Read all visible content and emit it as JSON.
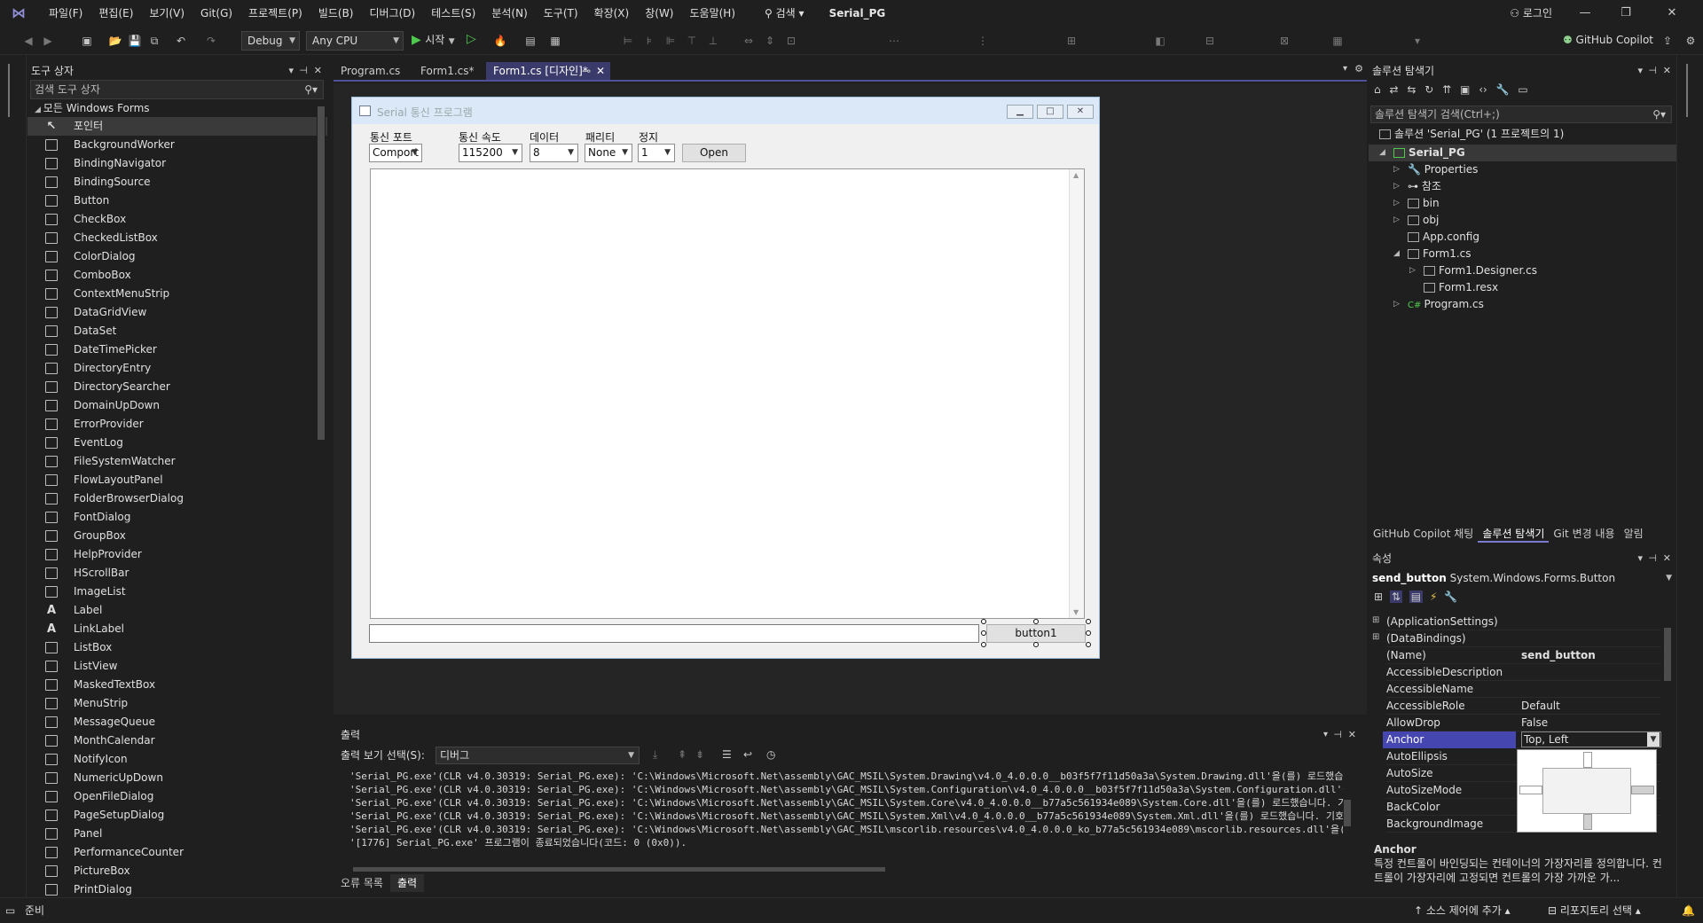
{
  "menu": {
    "items": [
      "파일(F)",
      "편집(E)",
      "보기(V)",
      "Git(G)",
      "프로젝트(P)",
      "빌드(B)",
      "디버그(D)",
      "테스트(S)",
      "분석(N)",
      "도구(T)",
      "확장(X)",
      "창(W)",
      "도움말(H)"
    ],
    "search": "검색",
    "app_title": "Serial_PG",
    "login": "로그인"
  },
  "toolbar": {
    "config": "Debug",
    "platform": "Any CPU",
    "start": "시작",
    "copilot": "GitHub Copilot"
  },
  "toolbox": {
    "title": "도구 상자",
    "search_placeholder": "검색 도구 상자",
    "group": "모든 Windows Forms",
    "items": [
      "포인터",
      "BackgroundWorker",
      "BindingNavigator",
      "BindingSource",
      "Button",
      "CheckBox",
      "CheckedListBox",
      "ColorDialog",
      "ComboBox",
      "ContextMenuStrip",
      "DataGridView",
      "DataSet",
      "DateTimePicker",
      "DirectoryEntry",
      "DirectorySearcher",
      "DomainUpDown",
      "ErrorProvider",
      "EventLog",
      "FileSystemWatcher",
      "FlowLayoutPanel",
      "FolderBrowserDialog",
      "FontDialog",
      "GroupBox",
      "HelpProvider",
      "HScrollBar",
      "ImageList",
      "Label",
      "LinkLabel",
      "ListBox",
      "ListView",
      "MaskedTextBox",
      "MenuStrip",
      "MessageQueue",
      "MonthCalendar",
      "NotifyIcon",
      "NumericUpDown",
      "OpenFileDialog",
      "PageSetupDialog",
      "Panel",
      "PerformanceCounter",
      "PictureBox",
      "PrintDialog"
    ]
  },
  "tabs": [
    "Program.cs",
    "Form1.cs*",
    "Form1.cs [디자인]*"
  ],
  "form": {
    "title": "Serial 통신 프로그램",
    "labels": {
      "port": "통신 포트",
      "baud": "통신 속도",
      "data": "데이터",
      "parity": "패리티",
      "stop": "정지"
    },
    "combos": {
      "port": "Comport",
      "baud": "115200",
      "data": "8",
      "parity": "None",
      "stop": "1"
    },
    "open": "Open",
    "button1": "button1"
  },
  "output": {
    "title": "출력",
    "source_label": "출력 보기 선택(S):",
    "source": "디버그",
    "lines": [
      "'Serial_PG.exe'(CLR v4.0.30319: Serial_PG.exe): 'C:\\Windows\\Microsoft.Net\\assembly\\GAC_MSIL\\System.Drawing\\v4.0_4.0.0.0__b03f5f7f11d50a3a\\System.Drawing.dll'을(를) 로드했습니다. 기호를 로",
      "'Serial_PG.exe'(CLR v4.0.30319: Serial_PG.exe): 'C:\\Windows\\Microsoft.Net\\assembly\\GAC_MSIL\\System.Configuration\\v4.0_4.0.0.0__b03f5f7f11d50a3a\\System.Configuration.dll'을(를) 로드했습니다",
      "'Serial_PG.exe'(CLR v4.0.30319: Serial_PG.exe): 'C:\\Windows\\Microsoft.Net\\assembly\\GAC_MSIL\\System.Core\\v4.0_4.0.0.0__b77a5c561934e089\\System.Core.dll'을(를) 로드했습니다. 기호를 로드하지",
      "'Serial_PG.exe'(CLR v4.0.30319: Serial_PG.exe): 'C:\\Windows\\Microsoft.Net\\assembly\\GAC_MSIL\\System.Xml\\v4.0_4.0.0.0__b77a5c561934e089\\System.Xml.dll'을(를) 로드했습니다. 기호를 로드하지 않",
      "'Serial_PG.exe'(CLR v4.0.30319: Serial_PG.exe): 'C:\\Windows\\Microsoft.Net\\assembly\\GAC_MSIL\\mscorlib.resources\\v4.0_4.0.0.0_ko_b77a5c561934e089\\mscorlib.resources.dll'을(를) 로드했습니다.",
      "'[1776] Serial_PG.exe' 프로그램이 종료되었습니다(코드: 0 (0x0))."
    ],
    "tabs": [
      "오류 목록",
      "출력"
    ]
  },
  "solution": {
    "title": "솔루션 탐색기",
    "search_placeholder": "솔루션 탐색기 검색(Ctrl+;)",
    "root": "솔루션 'Serial_PG' (1 프로젝트의 1)",
    "project": "Serial_PG",
    "nodes": [
      "Properties",
      "참조",
      "bin",
      "obj",
      "App.config",
      "Form1.cs",
      "Form1.Designer.cs",
      "Form1.resx",
      "Program.cs"
    ],
    "bottom_tabs": [
      "GitHub Copilot 채팅",
      "솔루션 탐색기",
      "Git 변경 내용",
      "알림"
    ]
  },
  "properties": {
    "title": "속성",
    "object_name": "send_button",
    "object_type": "System.Windows.Forms.Button",
    "rows": [
      {
        "name": "(ApplicationSettings)",
        "value": ""
      },
      {
        "name": "(DataBindings)",
        "value": ""
      },
      {
        "name": "(Name)",
        "value": "send_button"
      },
      {
        "name": "AccessibleDescription",
        "value": ""
      },
      {
        "name": "AccessibleName",
        "value": ""
      },
      {
        "name": "AccessibleRole",
        "value": "Default"
      },
      {
        "name": "AllowDrop",
        "value": "False"
      },
      {
        "name": "Anchor",
        "value": "Top, Left"
      },
      {
        "name": "AutoEllipsis",
        "value": ""
      },
      {
        "name": "AutoSize",
        "value": ""
      },
      {
        "name": "AutoSizeMode",
        "value": ""
      },
      {
        "name": "BackColor",
        "value": ""
      },
      {
        "name": "BackgroundImage",
        "value": ""
      }
    ],
    "desc_title": "Anchor",
    "desc_text": "특정 컨트롤이 바인딩되는 컨테이너의 가장자리를 정의합니다. 컨트롤이 가장자리에 고정되면 컨트롤의 가장 가까운 가..."
  },
  "status": {
    "ready": "준비",
    "source_control": "소스 제어에 추가",
    "repository": "리포지토리 선택"
  }
}
